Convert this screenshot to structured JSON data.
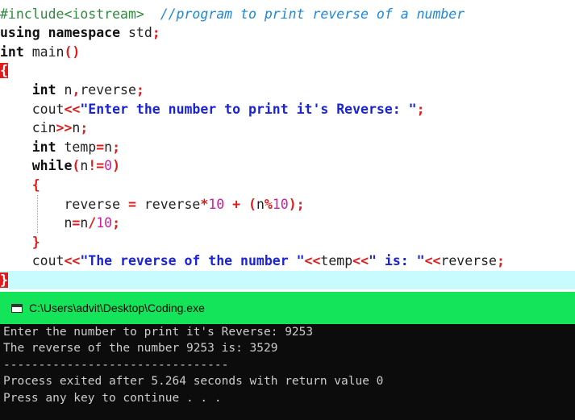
{
  "editor": {
    "lines": [
      [
        {
          "text": "#include<iostream>",
          "cls": "t-pre"
        },
        {
          "text": "  ",
          "cls": "t-id"
        },
        {
          "text": "//program to print reverse of a number",
          "cls": "t-com"
        }
      ],
      [
        {
          "text": "using",
          "cls": "t-kw"
        },
        {
          "text": " ",
          "cls": "t-id"
        },
        {
          "text": "namespace",
          "cls": "t-kw"
        },
        {
          "text": " std",
          "cls": "t-id"
        },
        {
          "text": ";",
          "cls": "t-sym"
        }
      ],
      [
        {
          "text": "int",
          "cls": "t-kw"
        },
        {
          "text": " main",
          "cls": "t-id"
        },
        {
          "text": "()",
          "cls": "t-sym"
        }
      ],
      [
        {
          "text": "{",
          "cls": "brace-box"
        }
      ],
      [
        {
          "text": "    ",
          "cls": "t-id"
        },
        {
          "text": "int",
          "cls": "t-kw"
        },
        {
          "text": " n",
          "cls": "t-id"
        },
        {
          "text": ",",
          "cls": "t-sym"
        },
        {
          "text": "reverse",
          "cls": "t-id"
        },
        {
          "text": ";",
          "cls": "t-sym"
        }
      ],
      [
        {
          "text": "    cout",
          "cls": "t-id"
        },
        {
          "text": "<<",
          "cls": "t-sym"
        },
        {
          "text": "\"Enter the number to print it's Reverse: \"",
          "cls": "t-str"
        },
        {
          "text": ";",
          "cls": "t-sym"
        }
      ],
      [
        {
          "text": "    cin",
          "cls": "t-id"
        },
        {
          "text": ">>",
          "cls": "t-sym"
        },
        {
          "text": "n",
          "cls": "t-id"
        },
        {
          "text": ";",
          "cls": "t-sym"
        }
      ],
      [
        {
          "text": "    ",
          "cls": "t-id"
        },
        {
          "text": "int",
          "cls": "t-kw"
        },
        {
          "text": " temp",
          "cls": "t-id"
        },
        {
          "text": "=",
          "cls": "t-sym"
        },
        {
          "text": "n",
          "cls": "t-id"
        },
        {
          "text": ";",
          "cls": "t-sym"
        }
      ],
      [
        {
          "text": "    ",
          "cls": "t-id"
        },
        {
          "text": "while",
          "cls": "t-kw"
        },
        {
          "text": "(",
          "cls": "t-sym"
        },
        {
          "text": "n",
          "cls": "t-id"
        },
        {
          "text": "!=",
          "cls": "t-sym"
        },
        {
          "text": "0",
          "cls": "t-num"
        },
        {
          "text": ")",
          "cls": "t-sym"
        }
      ],
      [
        {
          "text": "    ",
          "cls": "t-id"
        },
        {
          "text": "{",
          "cls": "t-sym"
        }
      ],
      [
        {
          "text": "        reverse ",
          "cls": "t-id"
        },
        {
          "text": "=",
          "cls": "t-sym"
        },
        {
          "text": " reverse",
          "cls": "t-id"
        },
        {
          "text": "*",
          "cls": "t-sym"
        },
        {
          "text": "10",
          "cls": "t-num"
        },
        {
          "text": " ",
          "cls": "t-id"
        },
        {
          "text": "+",
          "cls": "t-sym"
        },
        {
          "text": " ",
          "cls": "t-id"
        },
        {
          "text": "(",
          "cls": "t-sym"
        },
        {
          "text": "n",
          "cls": "t-id"
        },
        {
          "text": "%",
          "cls": "t-sym"
        },
        {
          "text": "10",
          "cls": "t-num"
        },
        {
          "text": ");",
          "cls": "t-sym"
        }
      ],
      [
        {
          "text": "        n",
          "cls": "t-id"
        },
        {
          "text": "=",
          "cls": "t-sym"
        },
        {
          "text": "n",
          "cls": "t-id"
        },
        {
          "text": "/",
          "cls": "t-sym"
        },
        {
          "text": "10",
          "cls": "t-num"
        },
        {
          "text": ";",
          "cls": "t-sym"
        }
      ],
      [
        {
          "text": "    ",
          "cls": "t-id"
        },
        {
          "text": "}",
          "cls": "t-sym"
        }
      ],
      [
        {
          "text": "    cout",
          "cls": "t-id"
        },
        {
          "text": "<<",
          "cls": "t-sym"
        },
        {
          "text": "\"The reverse of the number \"",
          "cls": "t-str"
        },
        {
          "text": "<<",
          "cls": "t-sym"
        },
        {
          "text": "temp",
          "cls": "t-id"
        },
        {
          "text": "<<",
          "cls": "t-sym"
        },
        {
          "text": "\" is: \"",
          "cls": "t-str"
        },
        {
          "text": "<<",
          "cls": "t-sym"
        },
        {
          "text": "reverse",
          "cls": "t-id"
        },
        {
          "text": ";",
          "cls": "t-sym"
        }
      ],
      [
        {
          "text": "}",
          "cls": "brace-box"
        }
      ]
    ]
  },
  "console": {
    "title": "C:\\Users\\advit\\Desktop\\Coding.exe",
    "lines": [
      "Enter the number to print it's Reverse: 9253",
      "The reverse of the number 9253 is: 3529",
      "--------------------------------",
      "Process exited after 5.264 seconds with return value 0",
      "Press any key to continue . . ."
    ]
  }
}
